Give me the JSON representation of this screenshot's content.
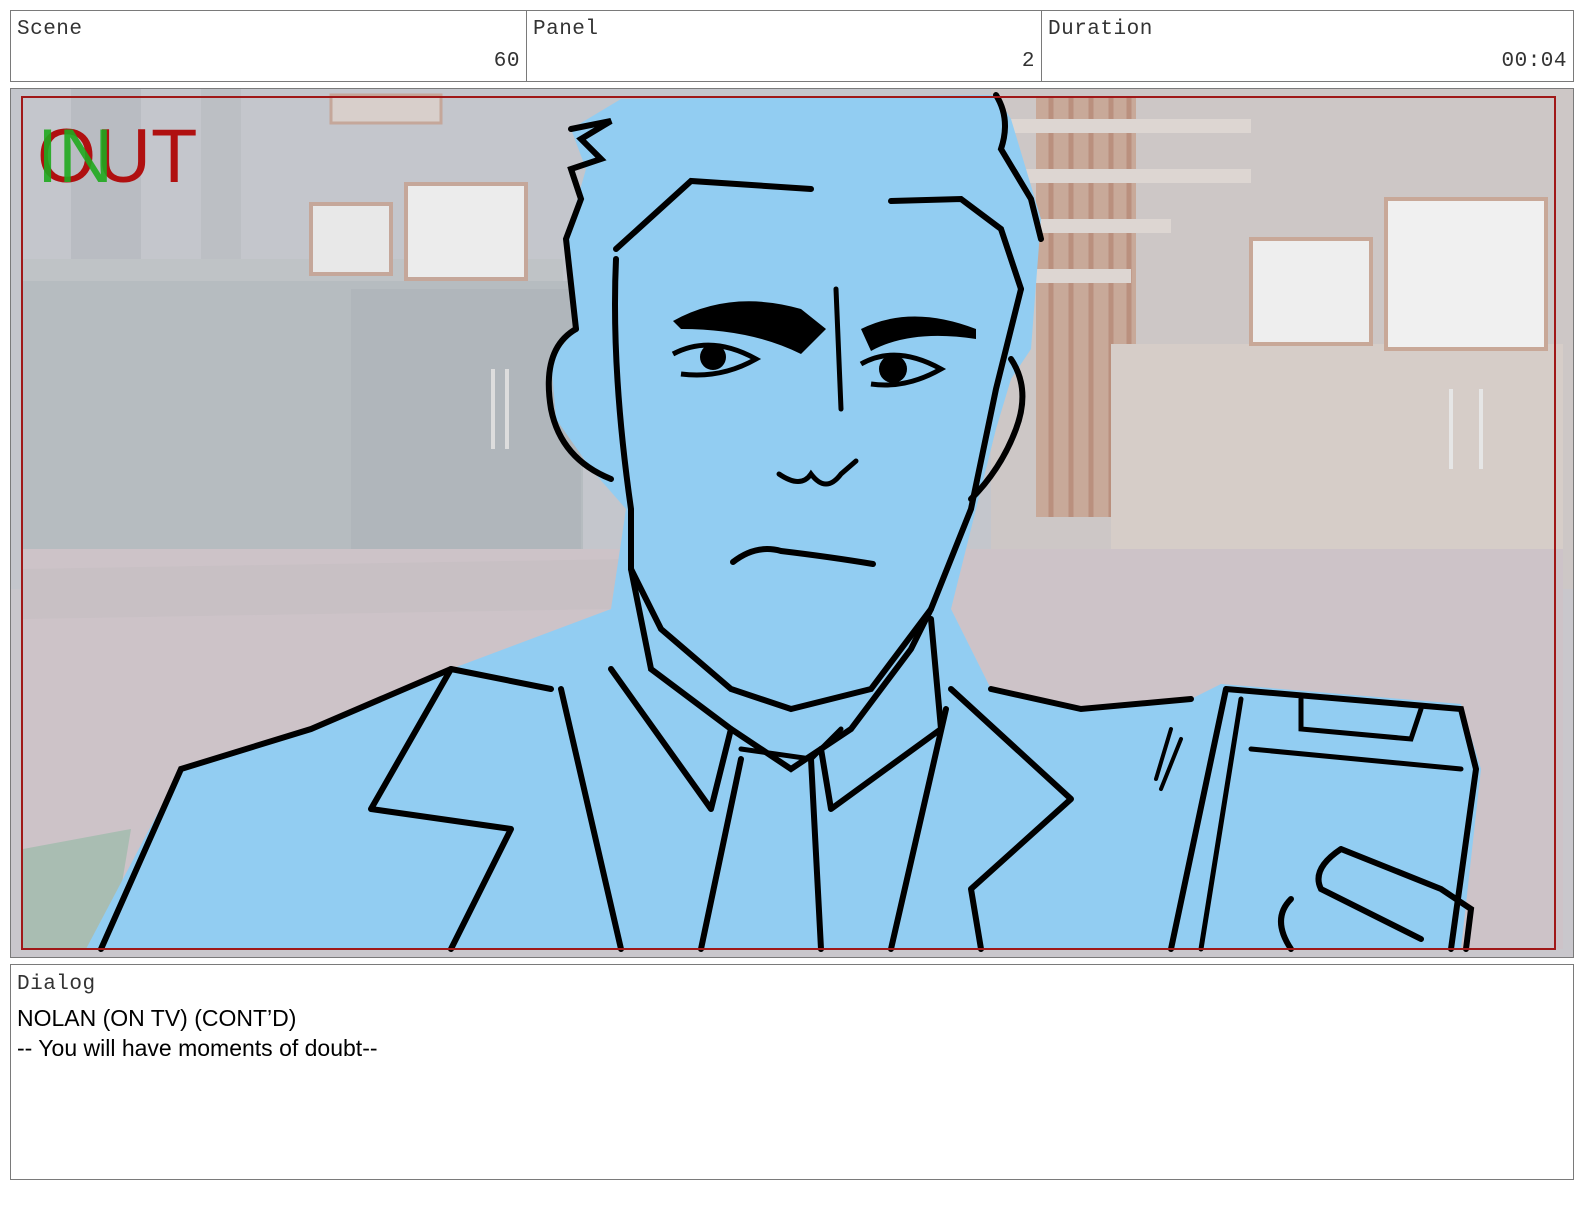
{
  "header": {
    "scene": {
      "label": "Scene",
      "value": "60"
    },
    "panel": {
      "label": "Panel",
      "value": "2"
    },
    "duration": {
      "label": "Duration",
      "value": "00:04"
    }
  },
  "panel_image": {
    "overlay": {
      "in_text": "IN",
      "out_text": "OUT",
      "in_color": "#1faa1f",
      "out_color": "#b01010"
    },
    "colors": {
      "frame_border": "#a01818",
      "figure_fill": "#92cdf2",
      "line": "#000000",
      "background": "#c8c6cb"
    }
  },
  "dialog": {
    "label": "Dialog",
    "lines": [
      "NOLAN (ON TV) (CONT’D)",
      "-- You will have moments of doubt--"
    ]
  }
}
